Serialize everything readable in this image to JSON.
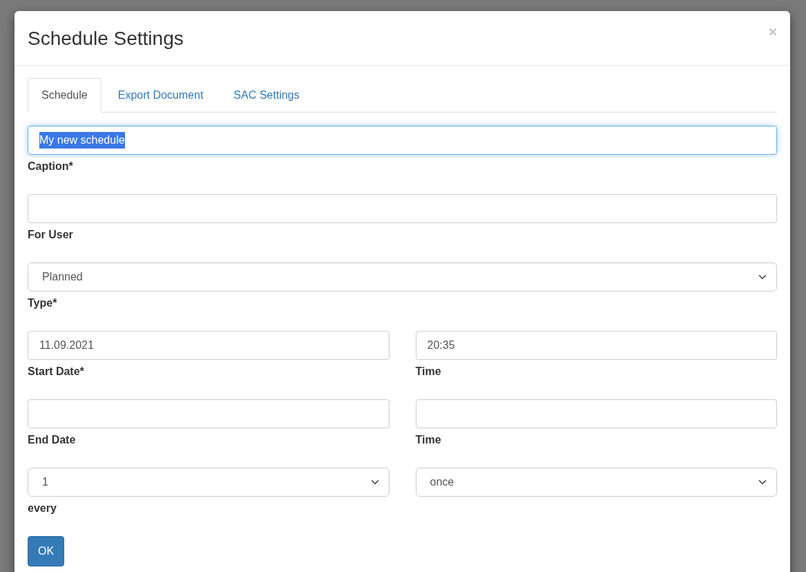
{
  "dialog": {
    "title": "Schedule Settings",
    "close": "×"
  },
  "tabs": [
    {
      "label": "Schedule",
      "selected": true
    },
    {
      "label": "Export Document",
      "selected": false
    },
    {
      "label": "SAC Settings",
      "selected": false
    }
  ],
  "form_rows": [
    {
      "fields": [
        {
          "kind": "text",
          "value": "My new schedule",
          "label": "Caption*",
          "focused": true
        }
      ]
    },
    {
      "fields": [
        {
          "kind": "text",
          "label": "For User",
          "focused": false
        }
      ]
    },
    {
      "fields": [
        {
          "kind": "select",
          "value": "Planned",
          "label": "Type*",
          "focused": false
        }
      ]
    },
    {
      "fields": [
        {
          "kind": "text",
          "value": "11.09.2021",
          "label": "Start Date*",
          "focused": false
        },
        {
          "kind": "text",
          "value": "20:35",
          "label": "Time",
          "focused": false
        }
      ]
    },
    {
      "fields": [
        {
          "kind": "text",
          "label": "End Date",
          "focused": false
        },
        {
          "kind": "text",
          "label": "Time",
          "focused": false
        }
      ]
    },
    {
      "fields": [
        {
          "kind": "select",
          "value": "1",
          "label": "every",
          "focused": false
        },
        {
          "kind": "select",
          "value": "once",
          "focused": false
        }
      ]
    }
  ],
  "buttons": [
    {
      "label": "OK"
    }
  ]
}
